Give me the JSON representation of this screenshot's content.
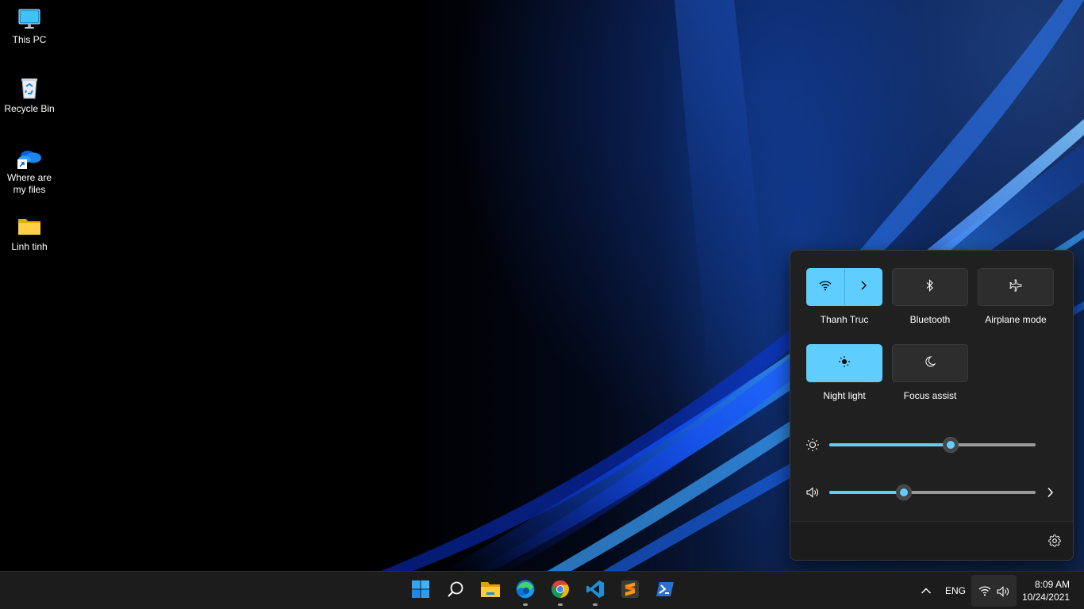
{
  "desktop": {
    "icons": [
      {
        "label": "This PC",
        "icon": "monitor-icon"
      },
      {
        "label": "Recycle Bin",
        "icon": "recycle-bin-icon"
      },
      {
        "label": "Where are my files",
        "icon": "onedrive-shortcut-icon"
      },
      {
        "label": "Linh tinh",
        "icon": "folder-icon"
      }
    ]
  },
  "quick_settings": {
    "tiles": [
      {
        "label": "Thanh Truc",
        "icon": "wifi-icon",
        "active": true,
        "has_arrow": true
      },
      {
        "label": "Bluetooth",
        "icon": "bluetooth-icon",
        "active": false
      },
      {
        "label": "Airplane mode",
        "icon": "airplane-icon",
        "active": false
      },
      {
        "label": "Night light",
        "icon": "night-light-icon",
        "active": true
      },
      {
        "label": "Focus assist",
        "icon": "moon-icon",
        "active": false
      }
    ],
    "brightness": {
      "icon": "sun-icon",
      "value_percent": 59
    },
    "volume": {
      "icon": "speaker-icon",
      "value_percent": 36,
      "has_arrow": true
    },
    "footer": {
      "settings_icon": "gear-icon"
    },
    "accent_color": "#60cdff"
  },
  "taskbar": {
    "apps": [
      {
        "name": "Start",
        "icon": "windows-start-icon",
        "running": false
      },
      {
        "name": "Search",
        "icon": "search-icon",
        "running": false
      },
      {
        "name": "File Explorer",
        "icon": "file-explorer-icon",
        "running": false
      },
      {
        "name": "Microsoft Edge",
        "icon": "edge-icon",
        "running": true
      },
      {
        "name": "Google Chrome",
        "icon": "chrome-icon",
        "running": true
      },
      {
        "name": "Visual Studio Code",
        "icon": "vscode-icon",
        "running": true
      },
      {
        "name": "Sublime Text",
        "icon": "sublime-text-icon",
        "running": false
      },
      {
        "name": "PowerShell",
        "icon": "powershell-icon",
        "running": false
      }
    ],
    "tray": {
      "overflow_icon": "chevron-up-icon",
      "language": "ENG",
      "network_icon": "wifi-icon",
      "volume_icon": "speaker-icon",
      "time": "8:09 AM",
      "date": "10/24/2021"
    }
  }
}
